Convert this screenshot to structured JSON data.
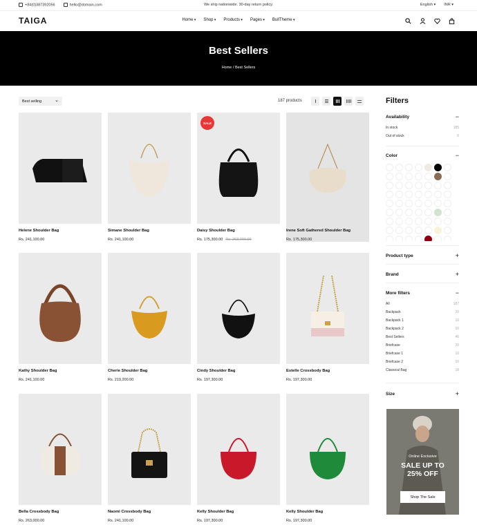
{
  "topbar": {
    "phone": "+84(0)387392056",
    "email": "hello@domain.com",
    "notice": "We ship nationwide. 30-day return policy.",
    "language": "English",
    "currency": "INR"
  },
  "header": {
    "logo": "TAIGA",
    "nav": [
      "Home",
      "Shop",
      "Products",
      "Pages",
      "BullTheme"
    ]
  },
  "hero": {
    "title": "Best Sellers",
    "breadcrumb_home": "Home",
    "breadcrumb_sep": "/",
    "breadcrumb_current": "Best Sellers"
  },
  "toolbar": {
    "sort_label": "Best selling",
    "product_count": "187 products"
  },
  "products": [
    {
      "name": "Helene Shoulder Bag",
      "price": "Rs. 241,100.00"
    },
    {
      "name": "Simane Shoulder Bag",
      "price": "Rs. 241,100.00"
    },
    {
      "name": "Daisy Shoulder Bag",
      "price": "Rs. 175,300.00",
      "old_price": "Rs. 263,000.00",
      "badge": "SALE"
    },
    {
      "name": "Irene Soft Gathered Shoulder Bag",
      "price": "Rs. 175,300.00"
    },
    {
      "name": "Kathy Shoulder Bag",
      "price": "Rs. 241,100.00"
    },
    {
      "name": "Cherie Shoulder Bag",
      "price": "Rs. 219,200.00"
    },
    {
      "name": "Cindy Shoulder Bag",
      "price": "Rs. 197,300.00"
    },
    {
      "name": "Estelle Crossbody Bag",
      "price": "Rs. 197,300.00"
    },
    {
      "name": "Bella Crossbody Bag",
      "price": "Rs. 263,000.00"
    },
    {
      "name": "Naomi Crossbody Bag",
      "price": "Rs. 241,100.00"
    },
    {
      "name": "Kelly Shoulder Bag",
      "price": "Rs. 197,300.00"
    },
    {
      "name": "Kelly Shoulder Bag",
      "price": "Rs. 197,300.00"
    }
  ],
  "filters": {
    "title": "Filters",
    "availability": {
      "title": "Availability",
      "items": [
        {
          "label": "In stock",
          "count": "185"
        },
        {
          "label": "Out of stock",
          "count": "6"
        }
      ]
    },
    "color": {
      "title": "Color"
    },
    "product_type": {
      "title": "Product type"
    },
    "brand": {
      "title": "Brand"
    },
    "more_filters": {
      "title": "More filters",
      "items": [
        {
          "label": "All",
          "count": "187"
        },
        {
          "label": "Backpack",
          "count": "20"
        },
        {
          "label": "Backpack 1",
          "count": "10"
        },
        {
          "label": "Backpack 2",
          "count": "10"
        },
        {
          "label": "Best Sellers",
          "count": "46"
        },
        {
          "label": "Briefcase",
          "count": "20"
        },
        {
          "label": "Briefcase 1",
          "count": "10"
        },
        {
          "label": "Briefcase 2",
          "count": "10"
        },
        {
          "label": "Classical Bag",
          "count": "18"
        }
      ]
    },
    "size": {
      "title": "Size"
    }
  },
  "promo": {
    "line1": "Online Exclusive",
    "line2": "SALE UP TO",
    "line3": "25% OFF",
    "button": "Shop The Sale"
  },
  "colors": {
    "sale_badge": "#e53935",
    "black": "#000000",
    "accent": "#111111"
  }
}
